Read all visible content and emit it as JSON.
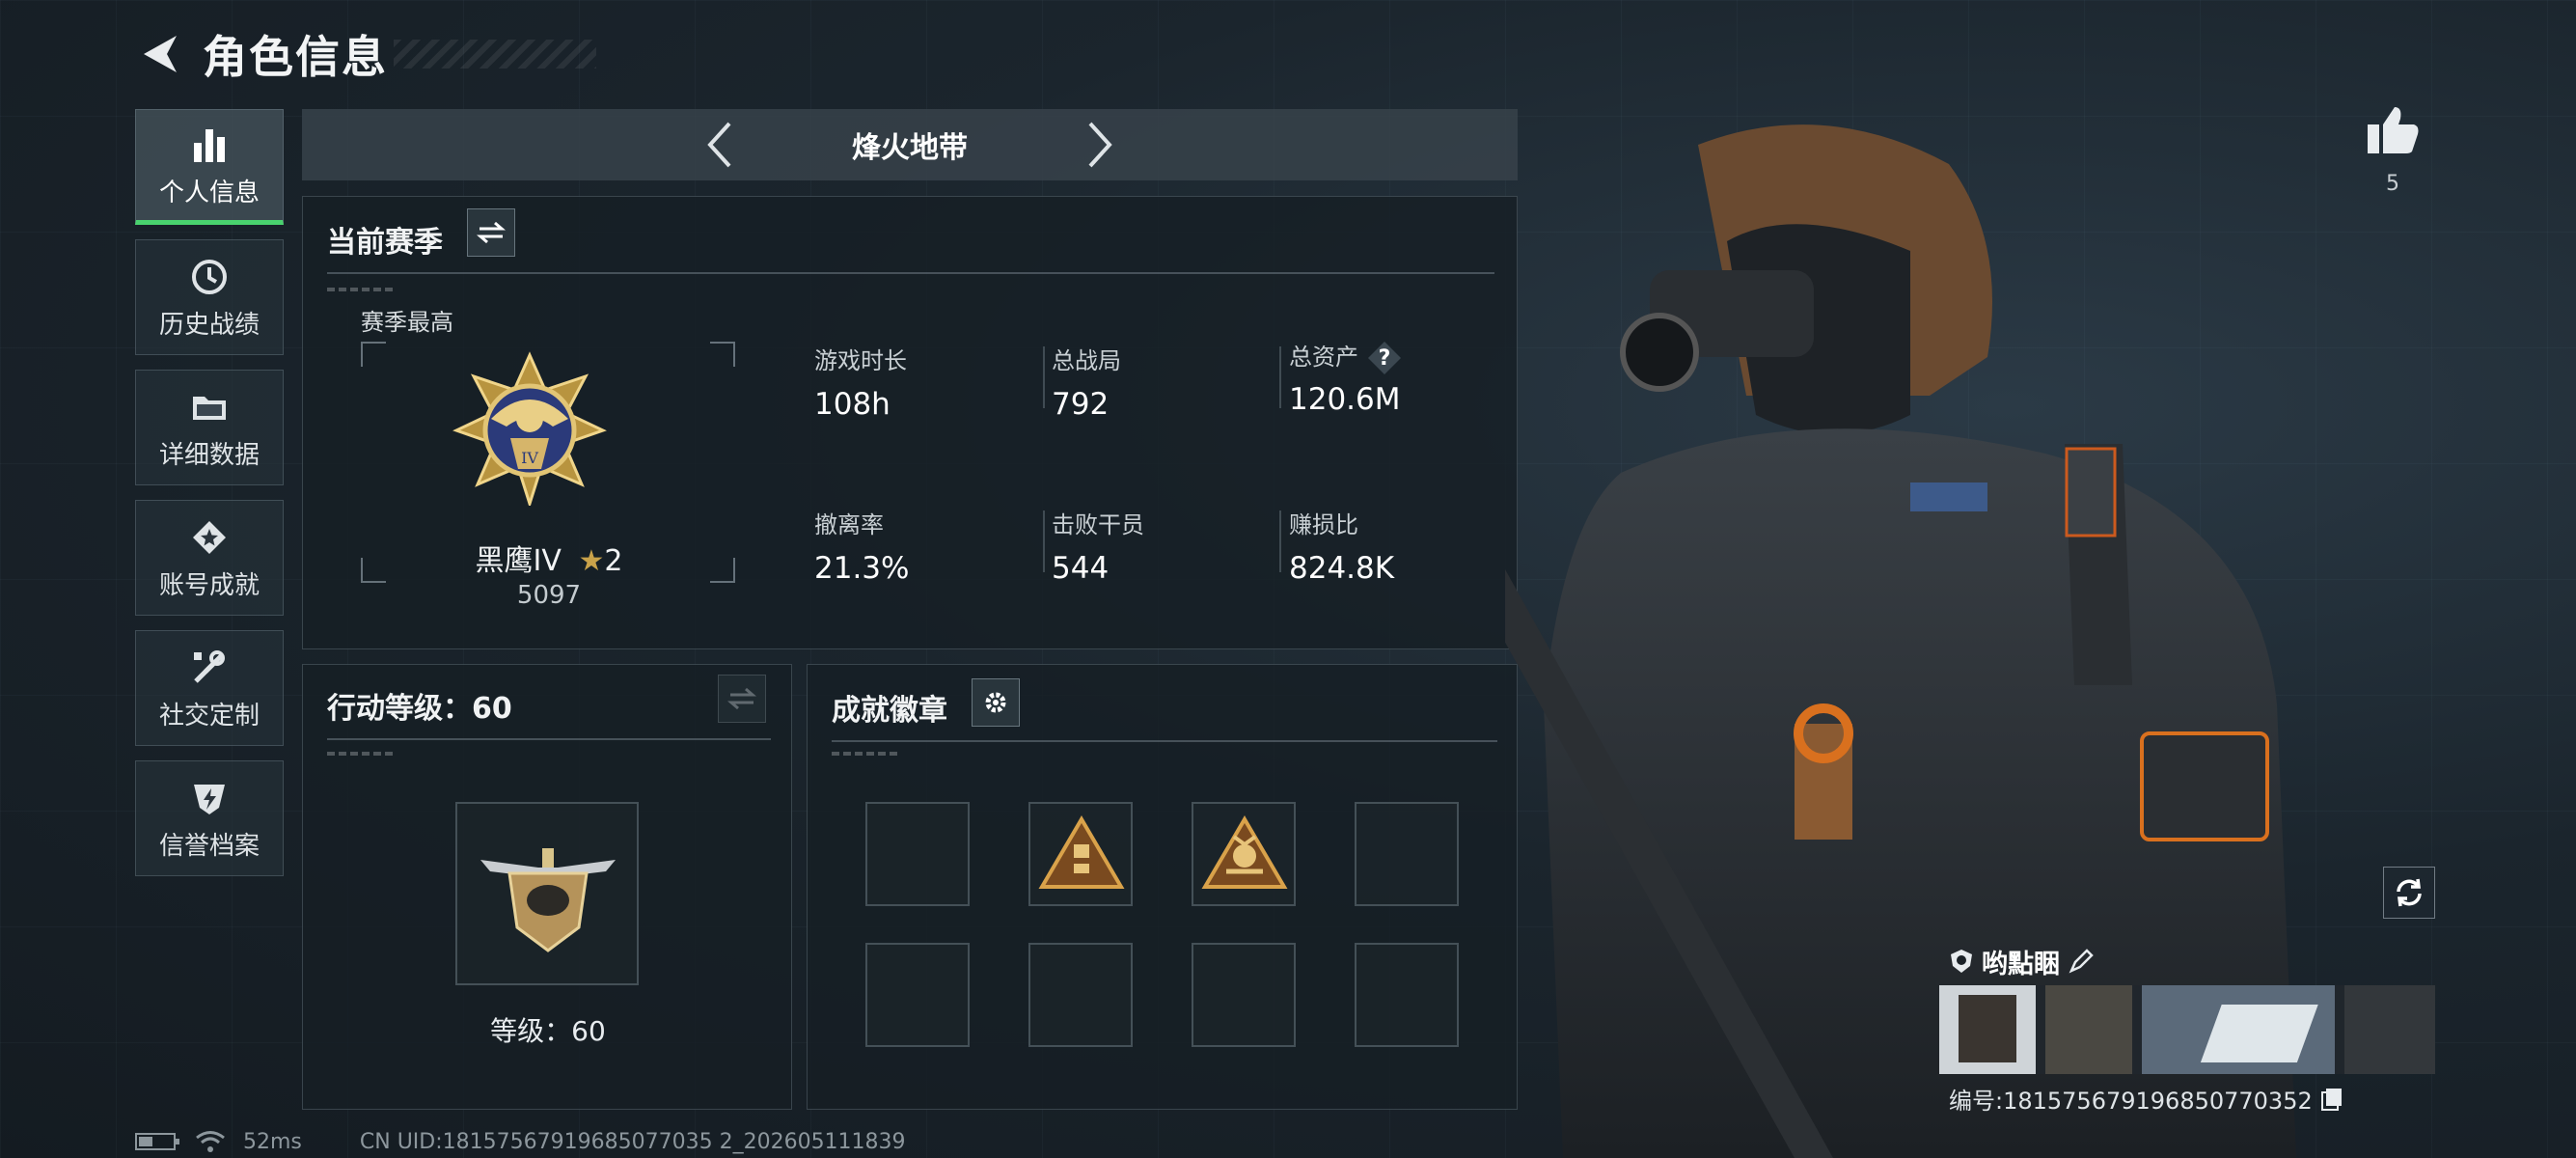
{
  "header": {
    "title": "角色信息"
  },
  "sidebar": {
    "items": [
      {
        "label": "个人信息",
        "icon": "bar-chart-icon",
        "active": true
      },
      {
        "label": "历史战绩",
        "icon": "history-icon",
        "active": false
      },
      {
        "label": "详细数据",
        "icon": "folder-icon",
        "active": false
      },
      {
        "label": "账号成就",
        "icon": "diamond-star-icon",
        "active": false
      },
      {
        "label": "社交定制",
        "icon": "tools-icon",
        "active": false
      },
      {
        "label": "信誉档案",
        "icon": "shield-bolt-icon",
        "active": false
      }
    ]
  },
  "map": {
    "name": "烽火地带"
  },
  "season": {
    "title": "当前赛季",
    "best_label": "赛季最高",
    "rank_name": "黑鹰IV",
    "rank_stars": "2",
    "rank_score": "5097",
    "stats": [
      {
        "label": "游戏时长",
        "value": "108h"
      },
      {
        "label": "总战局",
        "value": "792"
      },
      {
        "label": "总资产",
        "value": "120.6M",
        "help": "?"
      },
      {
        "label": "撤离率",
        "value": "21.3%"
      },
      {
        "label": "击败干员",
        "value": "544"
      },
      {
        "label": "赚损比",
        "value": "824.8K"
      }
    ]
  },
  "action_level": {
    "title": "行动等级：60",
    "level_text": "等级：60"
  },
  "achievements": {
    "title": "成就徽章",
    "slots": 8,
    "filled": [
      1,
      2
    ]
  },
  "profile": {
    "likes": "5",
    "player_name": "哟點睏",
    "player_id": "编号:18157567919685077035​2"
  },
  "footer": {
    "ping": "52ms",
    "uid": "CN UID:18157567919685077035 2_202605111839"
  },
  "colors": {
    "accent_green": "#49d26e",
    "gold": "#c9a24a",
    "badge_orange": "#d9701e"
  }
}
